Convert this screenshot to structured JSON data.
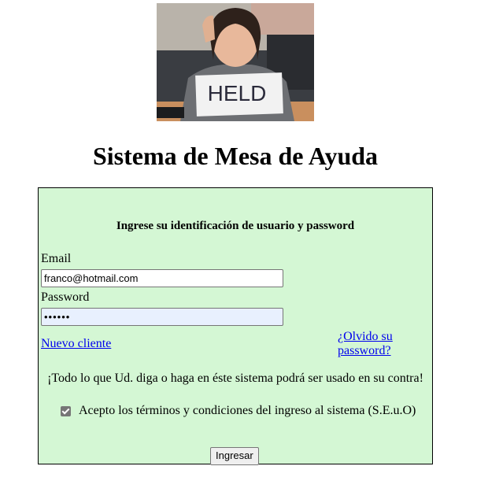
{
  "page": {
    "title": "Sistema de Mesa de Ayuda",
    "hero_sign_text": "HELD"
  },
  "login": {
    "subtitle": "Ingrese su identificación de usuario y password",
    "email_label": "Email",
    "email_value": "franco@hotmail.com",
    "password_label": "Password",
    "password_value": "••••••",
    "new_client_link": "Nuevo cliente",
    "forgot_password_link": "¿Olvido su password?",
    "warning": "¡Todo lo que Ud. diga o haga en éste sistema podrá ser usado en su contra!",
    "terms_label": "Acepto los términos y condiciones del ingreso al sistema (S.E.u.O)",
    "terms_checked": true,
    "submit_label": "Ingresar"
  },
  "colors": {
    "panel_background": "#d4f7d4",
    "link": "#0000ee"
  }
}
